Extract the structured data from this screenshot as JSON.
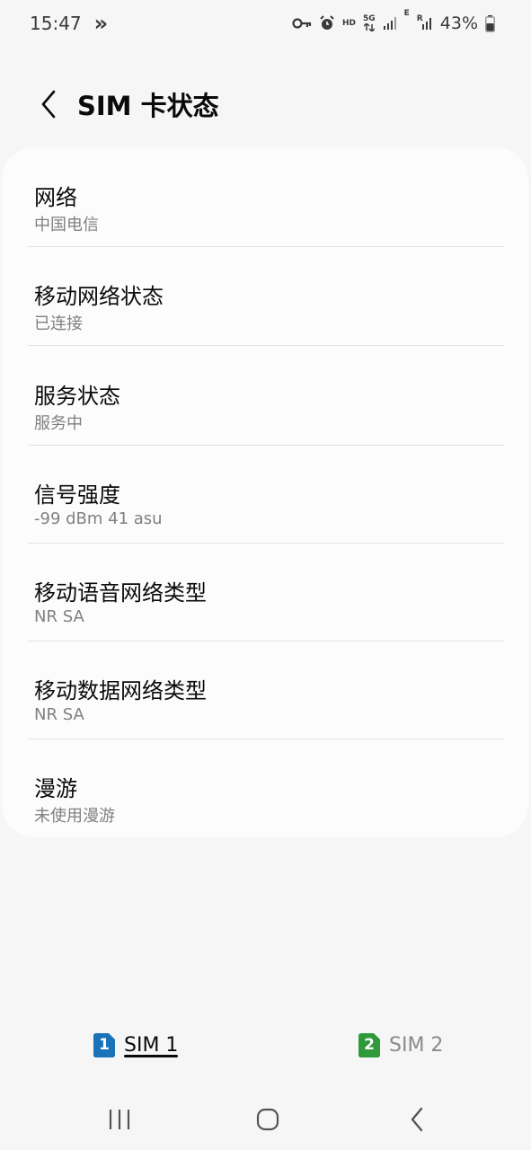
{
  "status_bar": {
    "time": "15:47",
    "overflow_glyph": "»",
    "network_5g": "5G",
    "hd": "HD",
    "edge": "E",
    "roaming_r": "R",
    "battery": "43%"
  },
  "header": {
    "title": "SIM 卡状态",
    "back_icon": "chevron-left-icon"
  },
  "rows": [
    {
      "title": "网络",
      "value": "中国电信"
    },
    {
      "title": "移动网络状态",
      "value": "已连接"
    },
    {
      "title": "服务状态",
      "value": "服务中"
    },
    {
      "title": "信号强度",
      "value": "-99 dBm 41 asu"
    },
    {
      "title": "移动语音网络类型",
      "value": "NR SA"
    },
    {
      "title": "移动数据网络类型",
      "value": "NR SA"
    },
    {
      "title": "漫游",
      "value": "未使用漫游"
    }
  ],
  "tabs": [
    {
      "label": "SIM 1",
      "badge": "1",
      "color": "#1a73b8",
      "selected": true
    },
    {
      "label": "SIM 2",
      "badge": "2",
      "color": "#2f9a3a",
      "selected": false
    }
  ],
  "nav": {
    "recents": "recents-icon",
    "home": "home-icon",
    "back": "back-icon"
  }
}
